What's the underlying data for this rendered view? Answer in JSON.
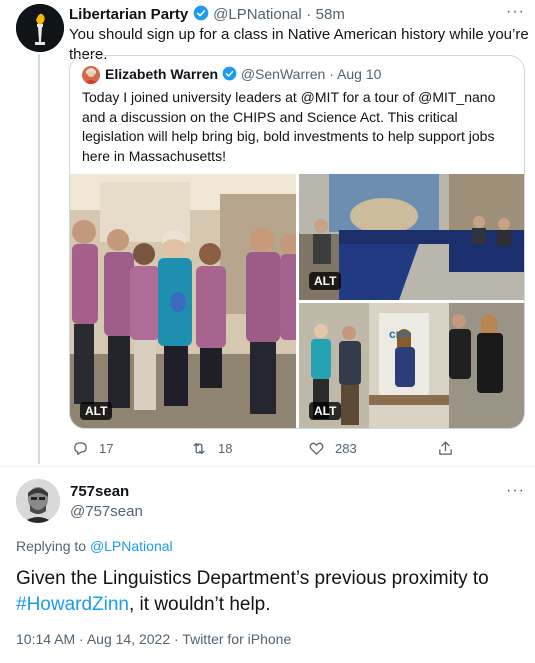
{
  "parent_tweet": {
    "author_name": "Libertarian Party",
    "author_handle": "@LPNational",
    "time": "58m",
    "text": "You should sign up for a class in Native American history while you’re there.",
    "more": "···"
  },
  "quoted_tweet": {
    "author_name": "Elizabeth Warren",
    "author_handle": "@SenWarren",
    "date": "Aug 10",
    "text": "Today I joined university leaders at @MIT for a tour of @MIT_nano and a discussion on the CHIPS and Science Act. This critical legislation will help bring big, bold investments to help support jobs here in Massachusetts!",
    "alt_label": "ALT",
    "photos": [
      {
        "alt": "ALT",
        "sign_text": ""
      },
      {
        "alt": "ALT",
        "sign_text": ""
      },
      {
        "alt": "ALT",
        "sign_text": "cnn"
      }
    ]
  },
  "actions": {
    "replies": "17",
    "retweets": "18",
    "likes": "283"
  },
  "reply_tweet": {
    "author_name": "757sean",
    "author_handle": "@757sean",
    "more": "···",
    "replying_to_label": "Replying to",
    "replying_to_handle": "@LPNational",
    "text_before": "Given the Linguistics Department’s previous proximity to ",
    "hashtag": "#HowardZinn",
    "text_after": ", it wouldn’t help.",
    "timestamp": "10:14 AM · Aug 14, 2022 · Twitter for iPhone"
  },
  "colors": {
    "accent": "#1d9bf0",
    "secondary_text": "#536471",
    "border": "#cfd9de"
  }
}
